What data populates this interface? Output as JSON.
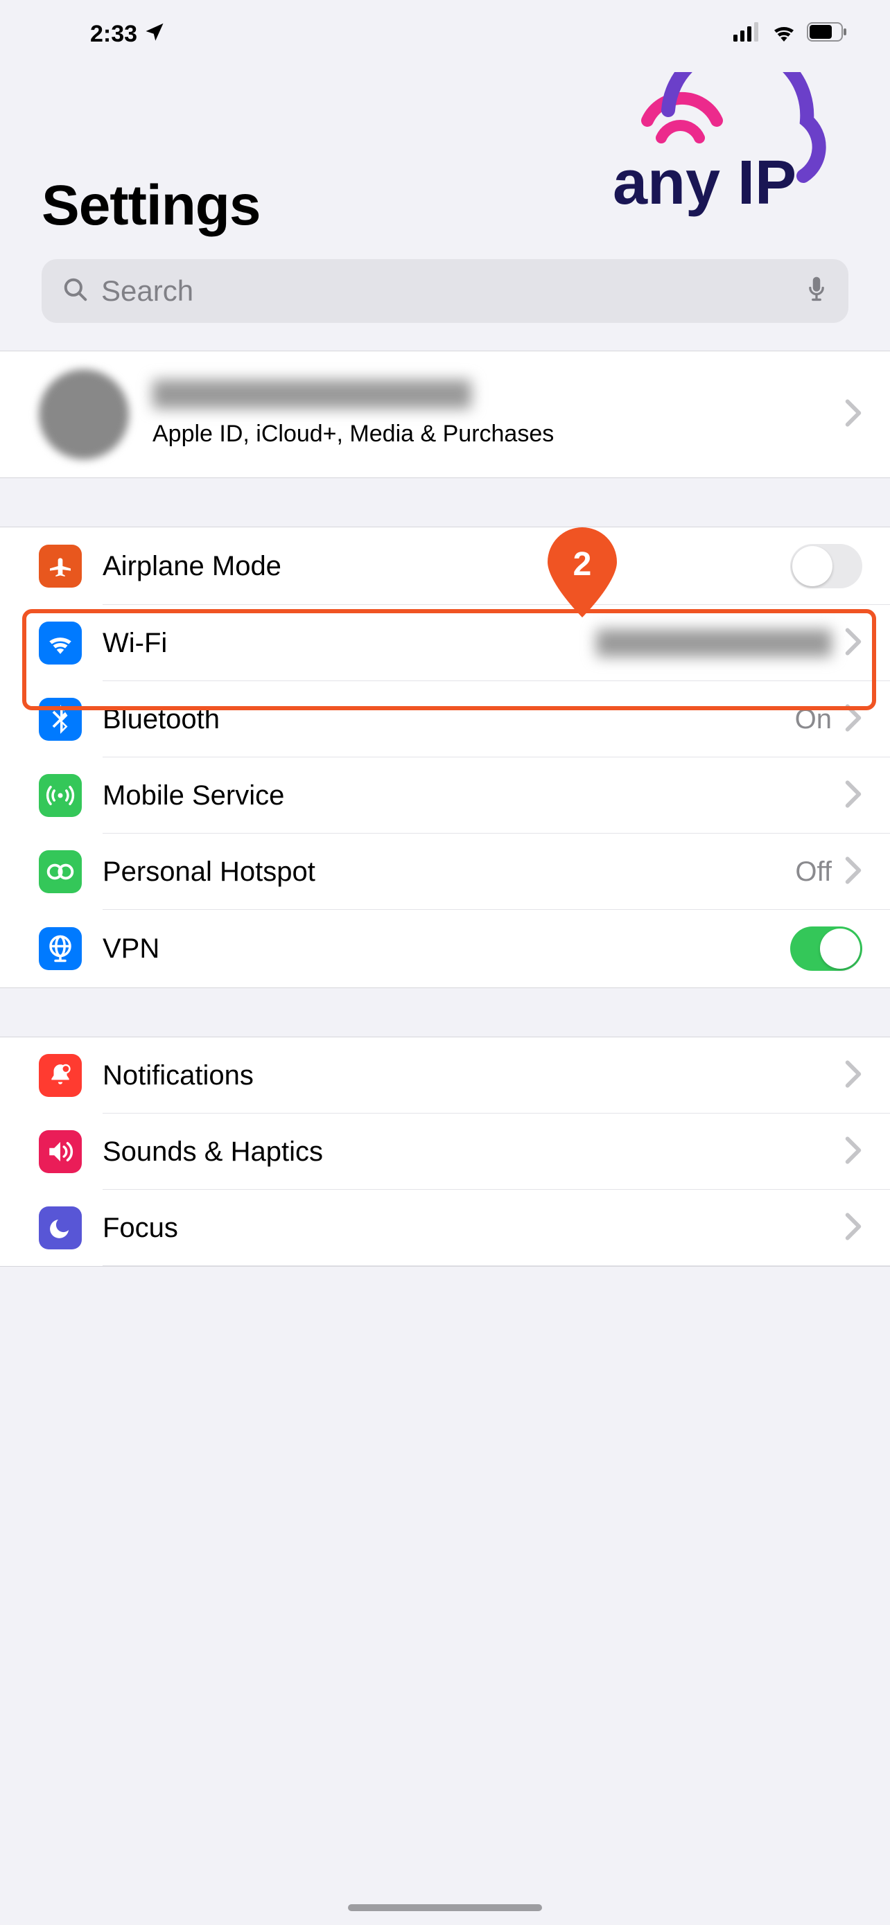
{
  "status": {
    "time": "2:33"
  },
  "header": {
    "title": "Settings",
    "logo_text": "anyIP"
  },
  "search": {
    "placeholder": "Search"
  },
  "account": {
    "subtitle": "Apple ID, iCloud+, Media & Purchases"
  },
  "annotation": {
    "pin_number": "2"
  },
  "rows": {
    "airplane": {
      "label": "Airplane Mode",
      "icon_bg": "#ff9500"
    },
    "wifi": {
      "label": "Wi-Fi",
      "icon_bg": "#007aff"
    },
    "bluetooth": {
      "label": "Bluetooth",
      "value": "On",
      "icon_bg": "#007aff"
    },
    "mobile": {
      "label": "Mobile Service",
      "icon_bg": "#34c759"
    },
    "hotspot": {
      "label": "Personal Hotspot",
      "value": "Off",
      "icon_bg": "#34c759"
    },
    "vpn": {
      "label": "VPN",
      "icon_bg": "#007aff"
    },
    "notifications": {
      "label": "Notifications",
      "icon_bg": "#ff3b30"
    },
    "sounds": {
      "label": "Sounds & Haptics",
      "icon_bg": "#ea1d58"
    },
    "focus": {
      "label": "Focus",
      "icon_bg": "#5856d6"
    }
  }
}
